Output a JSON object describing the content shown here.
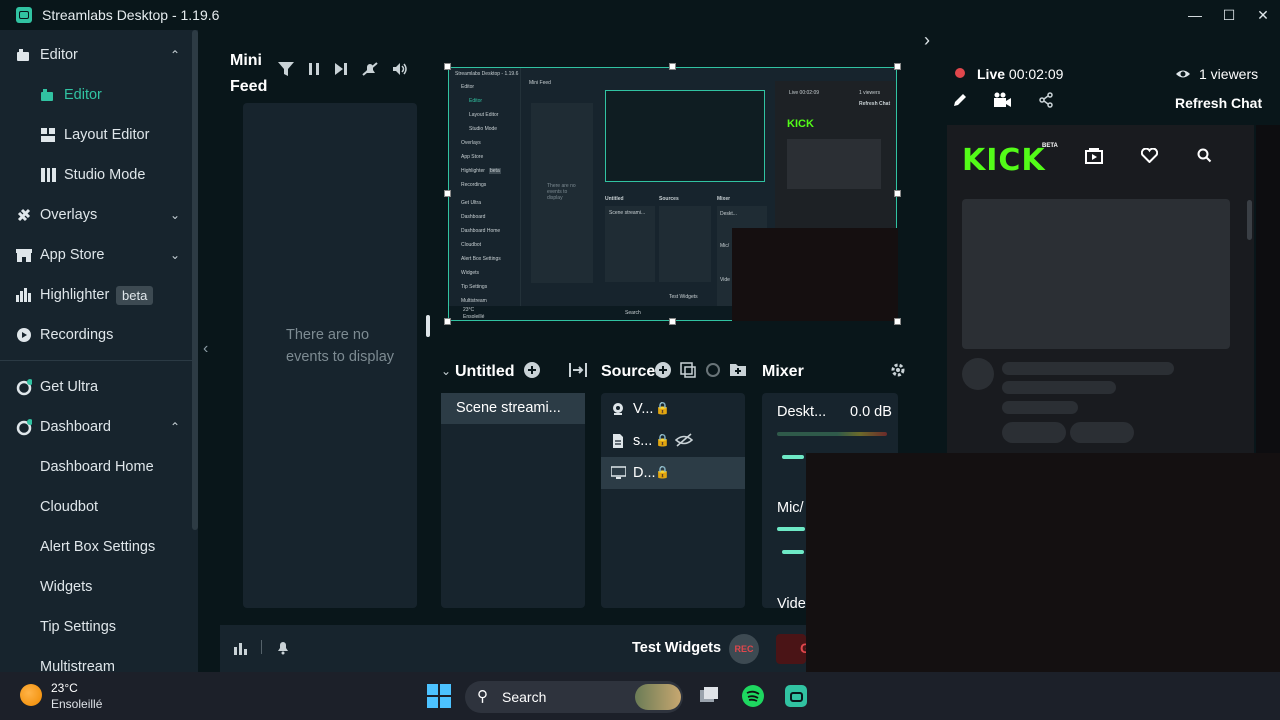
{
  "window": {
    "title": "Streamlabs Desktop - 1.19.6"
  },
  "sidebar": {
    "items": [
      {
        "label": "Editor",
        "icon": "editor-icon",
        "expanded": true
      },
      {
        "label": "Editor",
        "icon": "editor-icon",
        "active": true
      },
      {
        "label": "Layout Editor",
        "icon": "layout-icon"
      },
      {
        "label": "Studio Mode",
        "icon": "studio-mode-icon"
      },
      {
        "label": "Overlays",
        "icon": "overlays-icon"
      },
      {
        "label": "App Store",
        "icon": "store-icon"
      },
      {
        "label": "Highlighter",
        "icon": "highlighter-icon",
        "badge": "beta"
      },
      {
        "label": "Recordings",
        "icon": "recordings-icon"
      },
      {
        "label": "Get Ultra",
        "icon": "ultra-icon"
      },
      {
        "label": "Dashboard",
        "icon": "dashboard-icon",
        "expanded": true
      },
      {
        "label": "Dashboard Home"
      },
      {
        "label": "Cloudbot"
      },
      {
        "label": "Alert Box Settings"
      },
      {
        "label": "Widgets"
      },
      {
        "label": "Tip Settings"
      },
      {
        "label": "Multistream"
      }
    ]
  },
  "minifeed": {
    "title_line1": "Mini",
    "title_line2": "Feed",
    "empty_text": "There are no events to display"
  },
  "preview": {
    "title": "Streamlabs Desktop - 1.19.6",
    "nav": [
      "Editor",
      "Editor",
      "Layout Editor",
      "Studio Mode",
      "Overlays",
      "App Store",
      "Highlighter",
      "Recordings",
      "Get Ultra",
      "Dashboard",
      "Dashboard Home",
      "Cloudbot",
      "Alert Box Settings",
      "Widgets",
      "Tip Settings",
      "Multistream"
    ],
    "highlighter_badge": "beta",
    "minifeed_title": "Mini Feed",
    "empty": "There are no events to display",
    "untitled": "Untitled",
    "sources": "Sources",
    "mixer": "Mixer",
    "scene": "Scene streami...",
    "test_widgets": "Test Widgets",
    "live": "Live 00:02:09",
    "viewers": "1 viewers",
    "refresh": "Refresh Chat",
    "weather": "23°C",
    "weather_desc": "Ensoleillé",
    "search": "Search",
    "mixer_desktop": "Deskt...",
    "mixer_mic": "Mic/",
    "mixer_video": "Vide"
  },
  "scenes": {
    "title": "Untitled",
    "items": [
      "Scene streami..."
    ]
  },
  "sources": {
    "title": "Sources",
    "items": [
      {
        "name": "V...",
        "icon": "webcam-icon"
      },
      {
        "name": "s...",
        "icon": "file-icon"
      },
      {
        "name": "D...",
        "icon": "display-icon",
        "selected": true
      }
    ]
  },
  "mixer": {
    "title": "Mixer",
    "channels": [
      {
        "name": "Deskt...",
        "db": "0.0 dB"
      },
      {
        "name": "Mic/"
      },
      {
        "name": "Vide"
      }
    ]
  },
  "footer": {
    "test_widgets": "Test Widgets",
    "rec": "REC",
    "golive": "G"
  },
  "chat": {
    "live_label": "Live",
    "live_time": "00:02:09",
    "viewers": "1 viewers",
    "refresh": "Refresh Chat",
    "kick_logo": "KICK",
    "kick_beta": "BETA"
  },
  "taskbar": {
    "temp": "23°C",
    "weather": "Ensoleillé",
    "search": "Search"
  },
  "colors": {
    "accent": "#31c3a2",
    "live": "#e0474c",
    "kick": "#53fc18",
    "panel": "#17242d",
    "background": "#09161a"
  }
}
